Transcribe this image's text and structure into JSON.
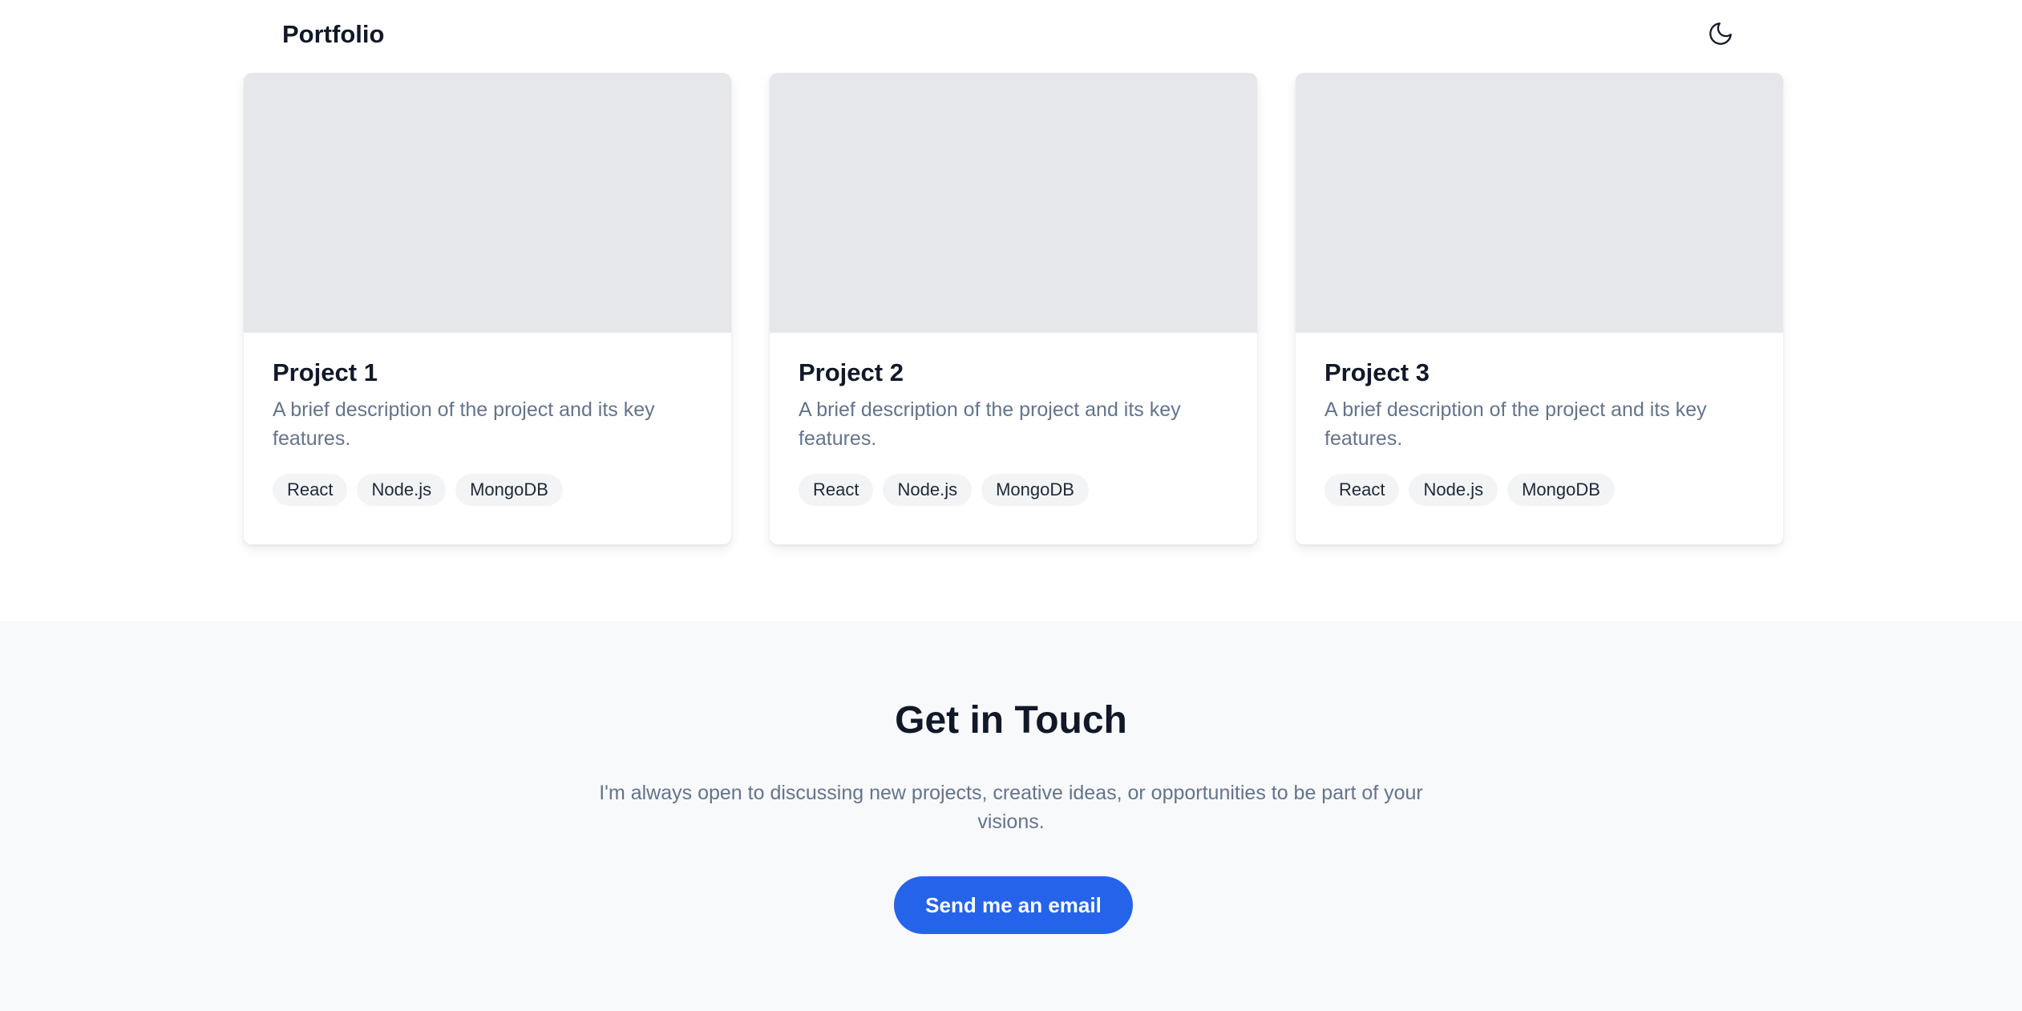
{
  "header": {
    "brand": "Portfolio",
    "theme_toggle_icon": "moon-icon"
  },
  "projects": [
    {
      "title": "Project 1",
      "description": "A brief description of the project and its key features.",
      "tags": [
        "React",
        "Node.js",
        "MongoDB"
      ]
    },
    {
      "title": "Project 2",
      "description": "A brief description of the project and its key features.",
      "tags": [
        "React",
        "Node.js",
        "MongoDB"
      ]
    },
    {
      "title": "Project 3",
      "description": "A brief description of the project and its key features.",
      "tags": [
        "React",
        "Node.js",
        "MongoDB"
      ]
    }
  ],
  "contact": {
    "title": "Get in Touch",
    "text": "I'm always open to discussing new projects, creative ideas, or opportunities to be part of your visions.",
    "button_label": "Send me an email"
  },
  "colors": {
    "accent": "#2563eb",
    "image_placeholder": "#e5e7eb",
    "section_background": "#f8f9fb",
    "muted_text": "#64748b"
  }
}
